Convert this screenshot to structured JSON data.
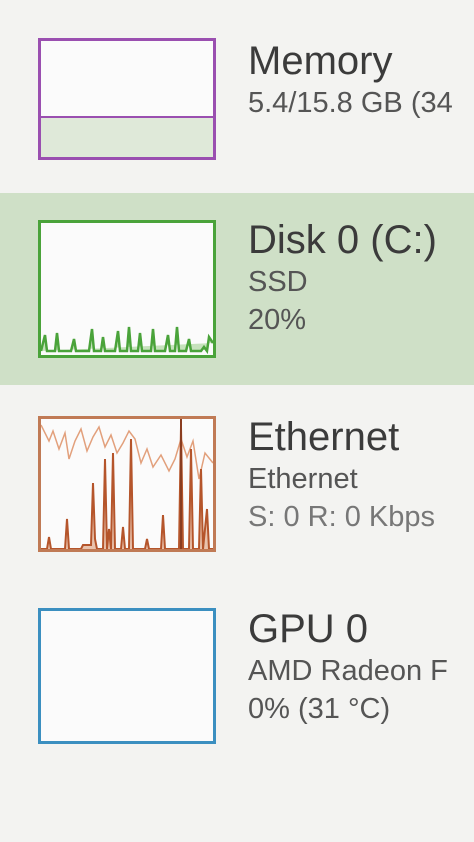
{
  "performance_list": {
    "items": [
      {
        "key": "memory",
        "title": "Memory",
        "lines": [
          "5.4/15.8 GB (34"
        ],
        "color": "#9a4fb0",
        "fill_fraction": 0.34,
        "selected": false
      },
      {
        "key": "disk",
        "title": "Disk 0 (C:)",
        "lines": [
          "SSD",
          "20%"
        ],
        "color": "#4aa33a",
        "selected": true
      },
      {
        "key": "ethernet",
        "title": "Ethernet",
        "lines": [
          "Ethernet",
          "S: 0 R: 0 Kbps"
        ],
        "color": "#b5552b",
        "selected": false
      },
      {
        "key": "gpu",
        "title": "GPU 0",
        "lines": [
          "AMD Radeon F",
          "0% (31 °C)"
        ],
        "color": "#3b8fc0",
        "selected": false
      }
    ]
  }
}
